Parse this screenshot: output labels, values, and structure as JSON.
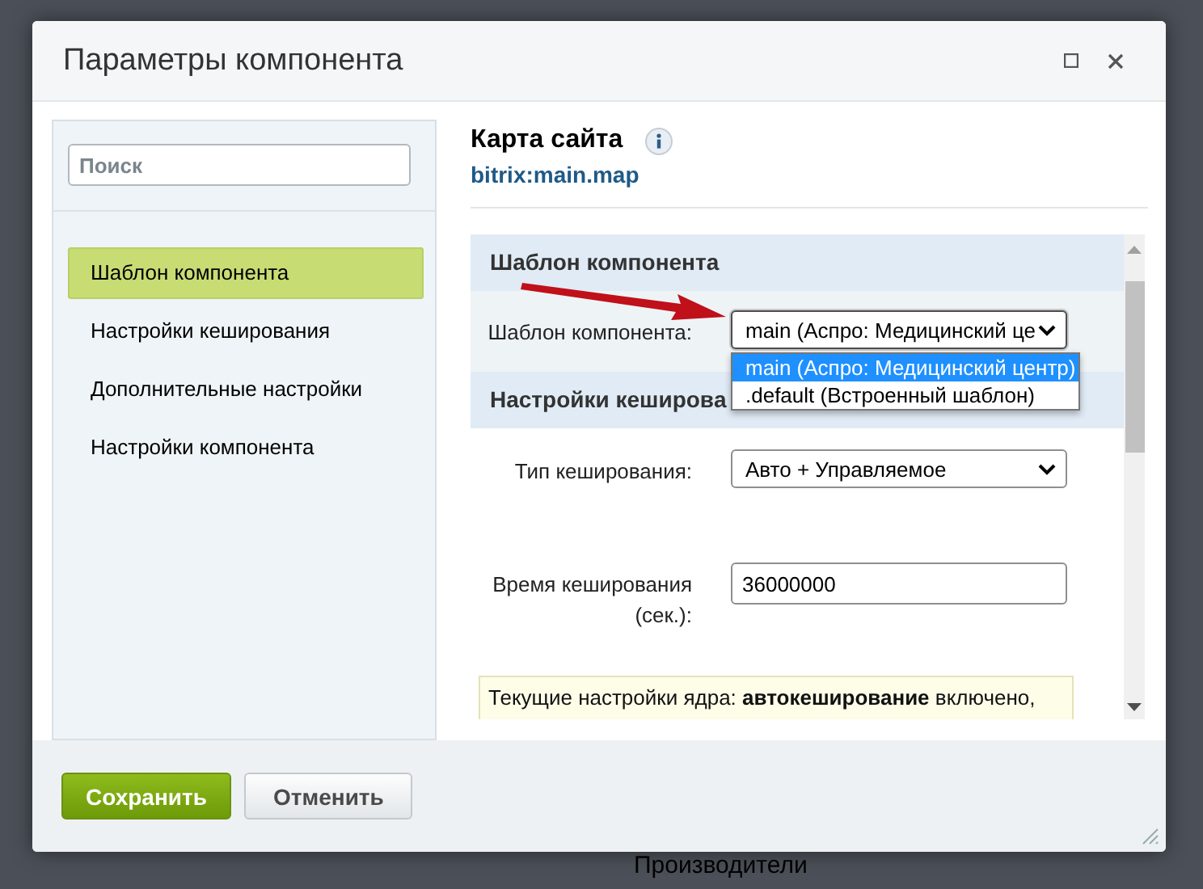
{
  "window": {
    "title": "Параметры компонента"
  },
  "sidebar": {
    "search": {
      "placeholder": "Поиск"
    },
    "items": [
      {
        "label": "Шаблон компонента",
        "selected": true
      },
      {
        "label": "Настройки кеширования",
        "selected": false
      },
      {
        "label": "Дополнительные настройки",
        "selected": false
      },
      {
        "label": "Настройки компонента",
        "selected": false
      }
    ]
  },
  "component": {
    "title": "Карта сайта",
    "code": "bitrix:main.map"
  },
  "sections": [
    {
      "title": "Шаблон компонента",
      "fields": [
        {
          "kind": "select",
          "label": "Шаблон компонента:",
          "value": "main (Аспро: Медицинский це",
          "expanded": true,
          "options": [
            {
              "label": "main (Аспро: Медицинский центр)",
              "selected": true
            },
            {
              "label": ".default (Встроенный шаблон)",
              "selected": false
            }
          ]
        }
      ]
    },
    {
      "title": "Настройки кешировa",
      "fields": [
        {
          "kind": "select",
          "label": "Тип кеширования:",
          "value": "Авто + Управляемое",
          "expanded": false
        },
        {
          "kind": "input",
          "label": "Время кеширования (сек.):",
          "value": "36000000"
        },
        {
          "kind": "note",
          "text": "Текущие настройки ядра: **автокеширование** включено,"
        }
      ]
    }
  ],
  "buttons": [
    {
      "label": "Сохранить",
      "kind": "primary"
    },
    {
      "label": "Отменить",
      "kind": "secondary"
    }
  ],
  "background_text": "Производители"
}
